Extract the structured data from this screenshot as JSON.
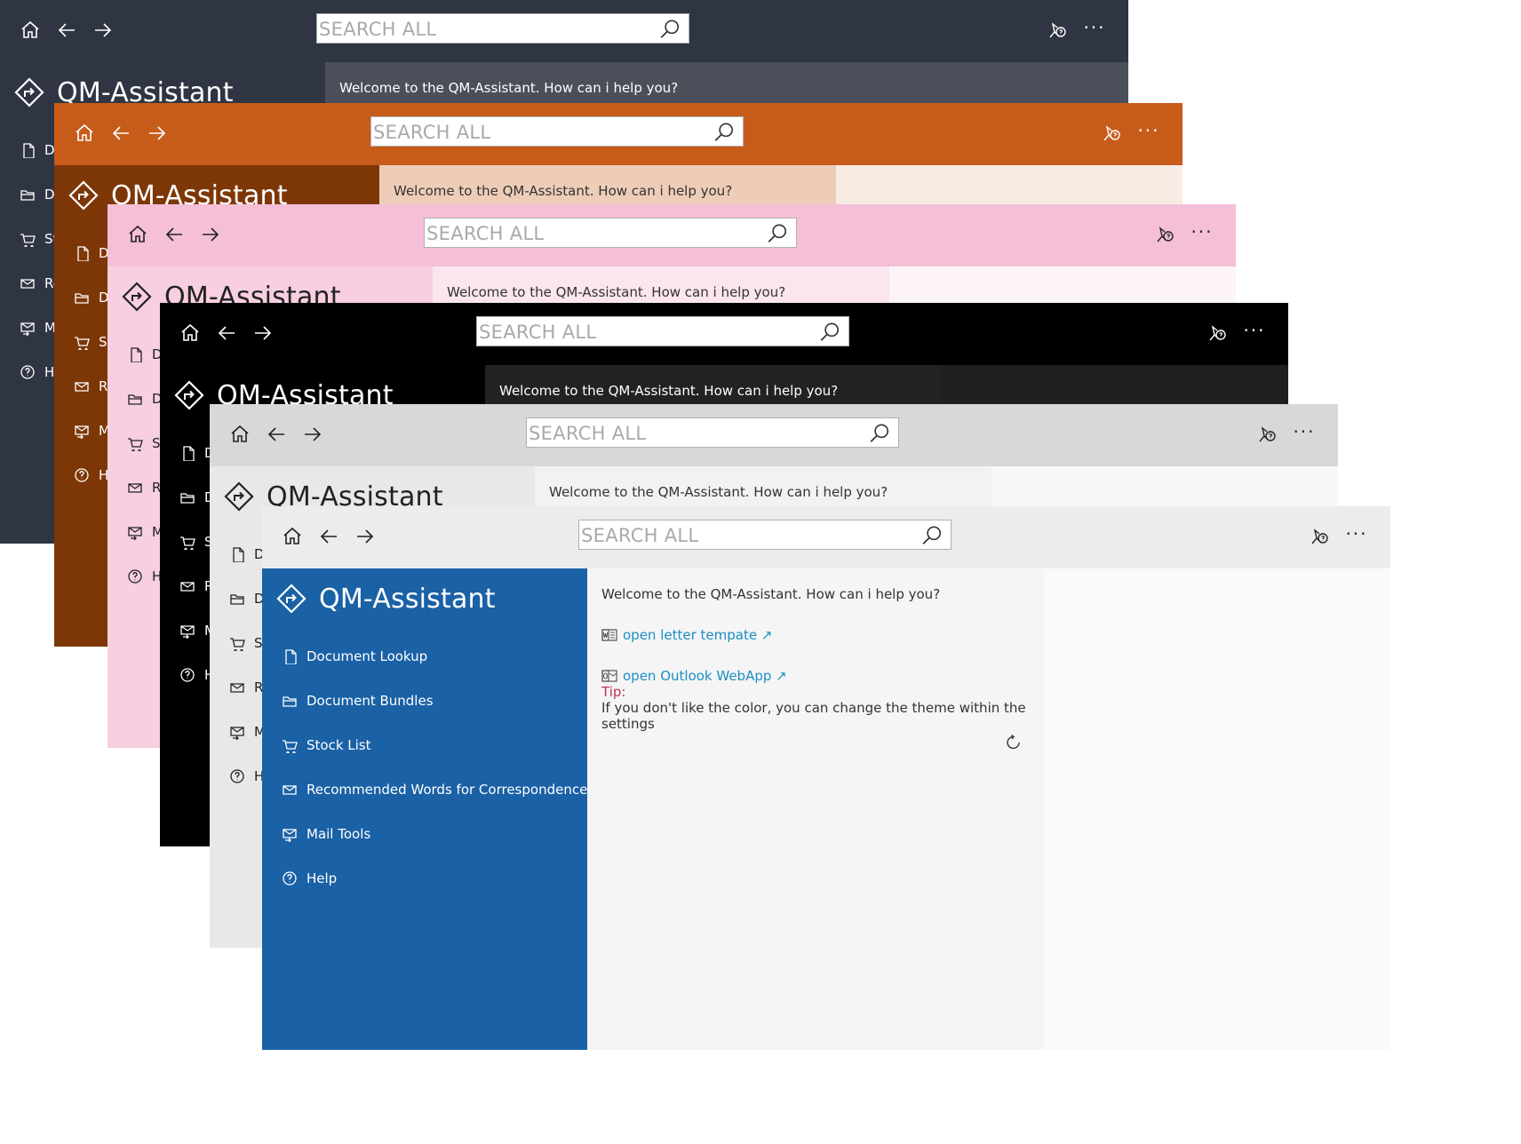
{
  "app": {
    "title": "QM-Assistant",
    "search_placeholder": "SEARCH ALL",
    "more_label": "···",
    "welcome": "Welcome to the QM-Assistant. How can i help you?"
  },
  "nav": [
    {
      "label": "Document Lookup",
      "icon": "document-icon"
    },
    {
      "label": "Document Bundles",
      "icon": "folder-icon"
    },
    {
      "label": "Stock List",
      "icon": "shopping-cart-icon"
    },
    {
      "label": "Recommended Words for Correspondence",
      "icon": "mail-icon"
    },
    {
      "label": "Mail Tools",
      "icon": "mail-tools-icon"
    },
    {
      "label": "Help",
      "icon": "help-icon"
    }
  ],
  "links": [
    {
      "label": "open letter tempate ↗",
      "icon": "word-icon"
    },
    {
      "label": "open Outlook WebApp ↗",
      "icon": "outlook-icon"
    }
  ],
  "tip": {
    "label": "Tip:",
    "text": "If you don't like the color, you can change the theme within the settings"
  },
  "themes": [
    {
      "name": "dark",
      "titlebar": "#2f3542",
      "titlebar_fg": "#ffffff",
      "sidebar": "#2f3542",
      "sidebar_fg": "#ffffff",
      "content": "#4a4f59",
      "message": "#4a4f59",
      "content_fg": "#ffffff"
    },
    {
      "name": "orange",
      "titlebar": "#c75c1a",
      "titlebar_fg": "#ffffff",
      "sidebar": "#7d3707",
      "sidebar_fg": "#ffffff",
      "content": "#f9ece5",
      "message": "#eecdb8",
      "content_fg": "#333333"
    },
    {
      "name": "pink",
      "titlebar": "#f5bfd7",
      "titlebar_fg": "#222222",
      "sidebar": "#f7cfe0",
      "sidebar_fg": "#222222",
      "content": "#fdf4f8",
      "message": "#fbe5ef",
      "content_fg": "#333333"
    },
    {
      "name": "black",
      "titlebar": "#000000",
      "titlebar_fg": "#ffffff",
      "sidebar": "#000000",
      "sidebar_fg": "#ffffff",
      "content": "#1f1f1f",
      "message": "#222222",
      "content_fg": "#ffffff"
    },
    {
      "name": "light-gray",
      "titlebar": "#d8d8d8",
      "titlebar_fg": "#222222",
      "sidebar": "#e8e8e8",
      "sidebar_fg": "#222222",
      "content": "#f8f8f8",
      "message": "#f2f2f2",
      "content_fg": "#333333"
    },
    {
      "name": "blue",
      "titlebar": "#ececec",
      "titlebar_fg": "#222222",
      "sidebar": "#1a61a5",
      "sidebar_fg": "#ffffff",
      "content": "#fafafa",
      "message": "#f5f5f5",
      "content_fg": "#333333",
      "accent_link": "#1a8fc2",
      "accent_tip": "#c4314b"
    }
  ]
}
